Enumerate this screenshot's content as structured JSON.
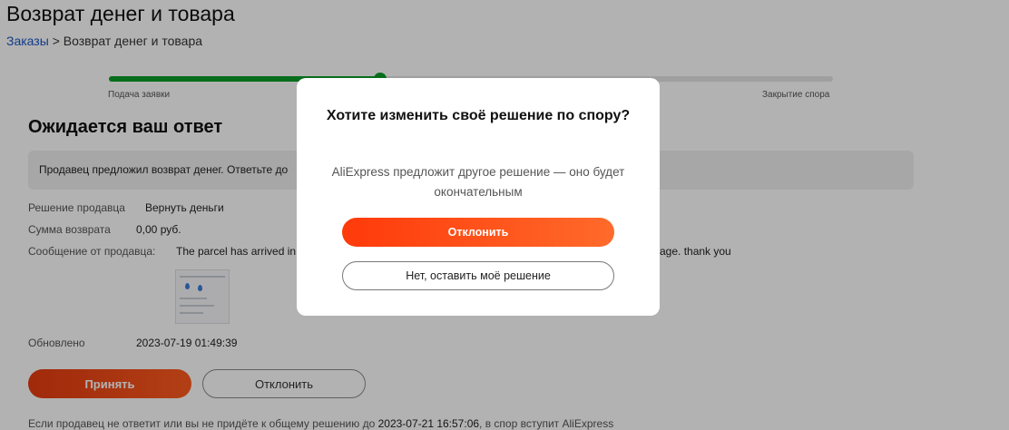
{
  "page": {
    "title": "Возврат денег и товара",
    "breadcrumb_link": "Заказы",
    "breadcrumb_separator": ">",
    "breadcrumb_current": "Возврат денег и товара"
  },
  "progress": {
    "step_start": "Подача заявки",
    "step_end": "Закрытие спора",
    "completed_fraction": 0.375,
    "color": "#0b9d27"
  },
  "dispute": {
    "title": "Ожидается ваш ответ",
    "notice_visible": "Продавец предложил возврат денег. Ответьте до",
    "decision_label": "Решение продавца",
    "decision_value": "Вернуть деньги",
    "amount_label": "Сумма возврата",
    "amount_value": "0,00 руб.",
    "message_label": "Сообщение от продавца:",
    "message_start": "The parcel has arrived in",
    "message_end": "age. thank you",
    "updated_label": "Обновлено",
    "updated_value": "2023-07-19 01:49:39",
    "accept_label": "Принять",
    "decline_label": "Отклонить",
    "footnote_before": "Если продавец не ответит или вы не придёте к общему решению до",
    "footnote_date": "2023-07-21 16:57:06",
    "footnote_after": ", в спор вступит AliExpress"
  },
  "modal": {
    "title": "Хотите изменить своё решение по спору?",
    "text": "AliExpress предложит другое решение — оно будет окончательным",
    "decline_label": "Отклонить",
    "keep_label": "Нет, оставить моё решение"
  },
  "colors": {
    "accent_start": "#ff3a0a",
    "accent_end": "#ff6a2a",
    "link": "#1a56c4"
  }
}
